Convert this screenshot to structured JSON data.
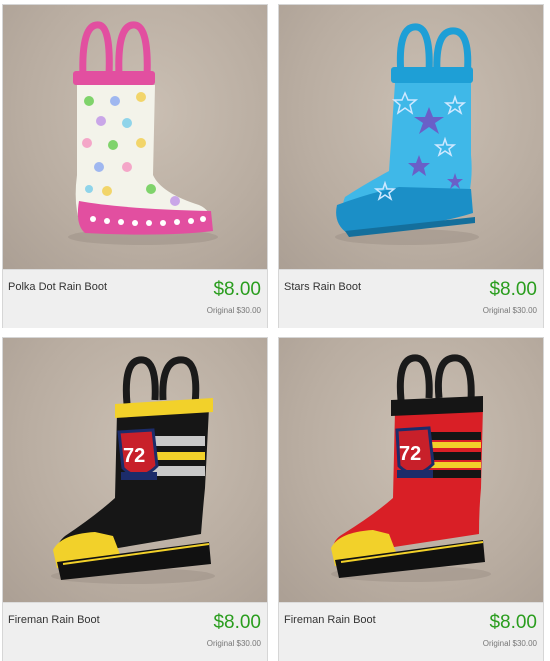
{
  "products": [
    {
      "name": "Polka Dot Rain Boot",
      "price": "$8.00",
      "original": "Original $30.00",
      "image": "polka-dot-boot"
    },
    {
      "name": "Stars Rain Boot",
      "price": "$8.00",
      "original": "Original $30.00",
      "image": "stars-boot"
    },
    {
      "name": "Fireman Rain Boot",
      "price": "$8.00",
      "original": "Original $30.00",
      "image": "fireman-boot-black"
    },
    {
      "name": "Fireman Rain Boot",
      "price": "$8.00",
      "original": "Original $30.00",
      "image": "fireman-boot-red"
    }
  ],
  "colors": {
    "price": "#2a9d1e",
    "card_bg": "#efefef"
  }
}
